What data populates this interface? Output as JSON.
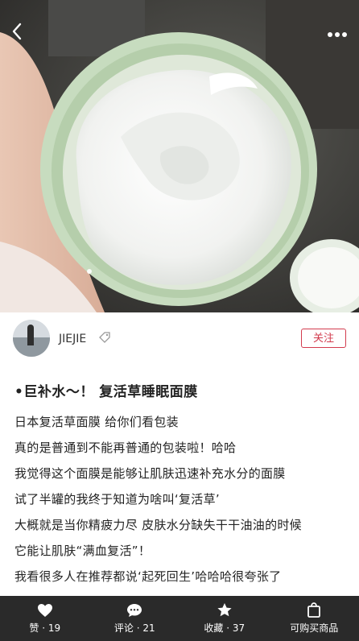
{
  "nav": {
    "back_icon": "chevron-left-icon",
    "more_icon": "more-dots-icon"
  },
  "author": {
    "name": "JIEJIE",
    "follow_label": "关注"
  },
  "post": {
    "title": "•巨补水～！ 复活草睡眠面膜",
    "lines": [
      "日本复活草面膜 给你们看包装",
      "真的是普通到不能再普通的包装啦！哈哈",
      "我觉得这个面膜是能够让肌肤迅速补充水分的面膜",
      "试了半罐的我终于知道为啥叫‘复活草’",
      "大概就是当你精疲力尽 皮肤水分缺失干干油油的时候",
      "它能让肌肤“满血复活”！",
      "我看很多人在推荐都说‘起死回生’哈哈哈很夸张了"
    ]
  },
  "bottom_bar": {
    "like": "赞 · 19",
    "comment": "评论 · 21",
    "collect": "收藏 · 37",
    "shop": "可购买商品"
  },
  "colors": {
    "accent": "#d23b4e",
    "bar_bg": "#2a2a2a"
  }
}
